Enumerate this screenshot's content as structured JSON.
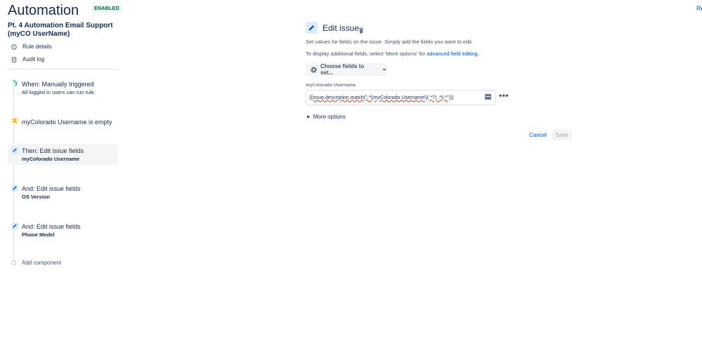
{
  "header": {
    "title": "Automation",
    "status_badge": "ENABLED",
    "top_right_link": "Re"
  },
  "colors": {
    "accent": "#0052cc",
    "trigger_green": "#36b37e",
    "condition_yellow": "#ffab00",
    "action_blue": "#0065ff"
  },
  "sidebar": {
    "rule_name": "Pt. 4 Automation Email Support (myCO UserName)",
    "links": [
      {
        "label": "Rule details",
        "icon": "info-icon"
      },
      {
        "label": "Audit log",
        "icon": "clipboard-icon"
      }
    ],
    "steps": [
      {
        "title": "When: Manually triggered",
        "subtitle": "All logged in users can run rule.",
        "icon": "trigger-icon",
        "kind": "trigger"
      },
      {
        "title": "myColorado Username is empty",
        "subtitle": "",
        "icon": "condition-icon",
        "kind": "condition"
      },
      {
        "title": "Then: Edit issue fields",
        "subtitle": "myColorado Username",
        "icon": "pencil-icon",
        "kind": "action",
        "active": true
      },
      {
        "title": "And: Edit issue fields",
        "subtitle": "OS Version",
        "icon": "pencil-icon",
        "kind": "action"
      },
      {
        "title": "And: Edit issue fields",
        "subtitle": "Phone Model",
        "icon": "pencil-icon",
        "kind": "action"
      }
    ],
    "add_component": "Add component"
  },
  "panel": {
    "title": "Edit issue",
    "description": "Set values for fields on the issue. Simply add the fields you want to edit.",
    "more_fields_prefix": "To display additional fields, select 'More options' for ",
    "more_fields_link": "advanced field editing",
    "more_fields_suffix": ".",
    "choose_fields_label": "Choose fields to set...",
    "field": {
      "label": "myColorado Username",
      "value": "{{issue.description.match(\".*\\(myColorado Username\\)(.*?) .*\\|.*\")}}"
    },
    "more_options_label": "More options",
    "cancel_label": "Cancel",
    "save_label": "Save"
  }
}
